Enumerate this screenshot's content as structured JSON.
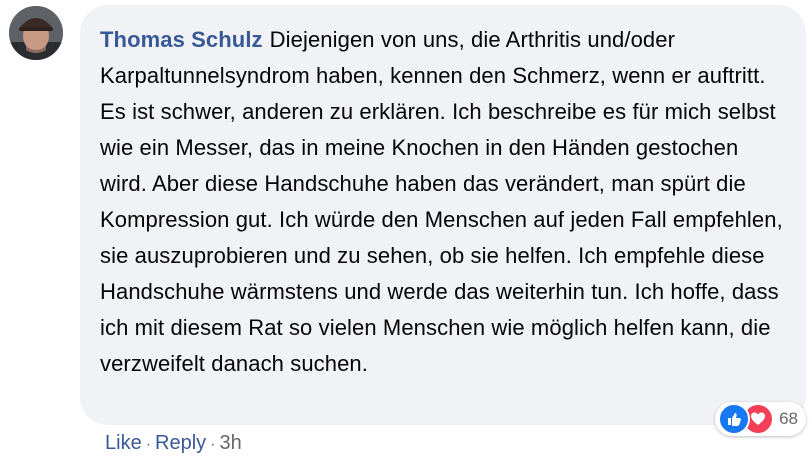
{
  "comment": {
    "author": "Thomas Schulz",
    "text": "Diejenigen von uns, die Arthritis und/oder Karpaltunnelsyndrom haben, kennen den Schmerz, wenn er auftritt. Es ist schwer, anderen zu erklären. Ich beschreibe es für mich selbst wie ein Messer, das in meine Knochen in den Händen gestochen wird. Aber diese Handschuhe haben das verändert, man spürt die Kompression gut. Ich würde den Menschen auf jeden Fall empfehlen, sie auszuprobieren und zu sehen, ob sie helfen. Ich empfehle diese Handschuhe wärmstens und werde das weiterhin tun. Ich hoffe, dass ich mit diesem Rat so vielen Menschen wie möglich helfen kann, die verzweifelt danach suchen."
  },
  "reactions": {
    "icons": [
      "like-icon",
      "love-icon"
    ],
    "count": "68",
    "colors": {
      "like": "#1877f2",
      "love": "#f33e58"
    }
  },
  "actions": {
    "like_label": "Like",
    "separator": "·",
    "reply_label": "Reply",
    "timestamp": "3h"
  },
  "colors": {
    "bubble_bg": "#f0f2f5",
    "name": "#385898",
    "text": "#050505",
    "meta": "#65676b"
  }
}
